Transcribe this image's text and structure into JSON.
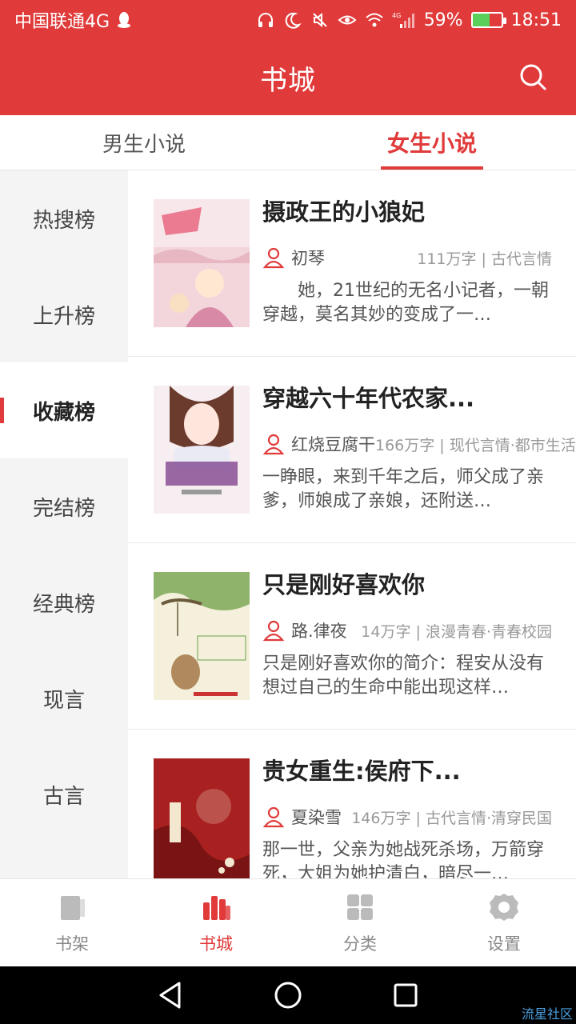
{
  "status_bar": {
    "carrier": "中国联通4G",
    "network": "4G",
    "battery": "59%",
    "battery_level": 0.59,
    "time": "18:51"
  },
  "header": {
    "title": "书城"
  },
  "gender_tabs": [
    {
      "label": "男生小说",
      "active": false
    },
    {
      "label": "女生小说",
      "active": true
    }
  ],
  "sidebar": {
    "items": [
      {
        "label": "热搜榜",
        "active": false
      },
      {
        "label": "上升榜",
        "active": false
      },
      {
        "label": "收藏榜",
        "active": true
      },
      {
        "label": "完结榜",
        "active": false
      },
      {
        "label": "经典榜",
        "active": false
      },
      {
        "label": "现言",
        "active": false
      },
      {
        "label": "古言",
        "active": false
      }
    ]
  },
  "books": [
    {
      "title": "摄政王的小狼妃",
      "author": "初琴",
      "stat": "111万字 | 古代言情",
      "desc": "　　她，21世纪的无名小记者，一朝穿越，莫名其妙的变成了一…",
      "cover_color": "#f3d6dc"
    },
    {
      "title": "穿越六十年代农家...",
      "author": "红烧豆腐干",
      "stat": "166万字 | 现代言情·都市生活",
      "desc": "一睁眼，来到千年之后，师父成了亲爹，师娘成了亲娘，还附送…",
      "cover_color": "#f6eef0"
    },
    {
      "title": "只是刚好喜欢你",
      "author": "路.律夜",
      "stat": "14万字 | 浪漫青春·青春校园",
      "desc": "只是刚好喜欢你的简介：程安从没有想过自己的生命中能出现这样…",
      "cover_color": "#f4f0dc"
    },
    {
      "title": "贵女重生:侯府下...",
      "author": "夏染雪",
      "stat": "146万字 | 古代言情·清穿民国",
      "desc": "那一世，父亲为她战死杀场，万箭穿死，大姐为她护清白，暗尽一…",
      "cover_color": "#a8201f"
    }
  ],
  "bottom_nav": [
    {
      "label": "书架",
      "icon": "bookshelf-icon",
      "active": false
    },
    {
      "label": "书城",
      "icon": "bookstore-icon",
      "active": true
    },
    {
      "label": "分类",
      "icon": "category-icon",
      "active": false
    },
    {
      "label": "设置",
      "icon": "settings-icon",
      "active": false
    }
  ],
  "watermark": "流星社区",
  "colors": {
    "accent": "#e03a3a",
    "sidebar_bg": "#f4f4f4",
    "inactive": "#bbbbbb"
  }
}
